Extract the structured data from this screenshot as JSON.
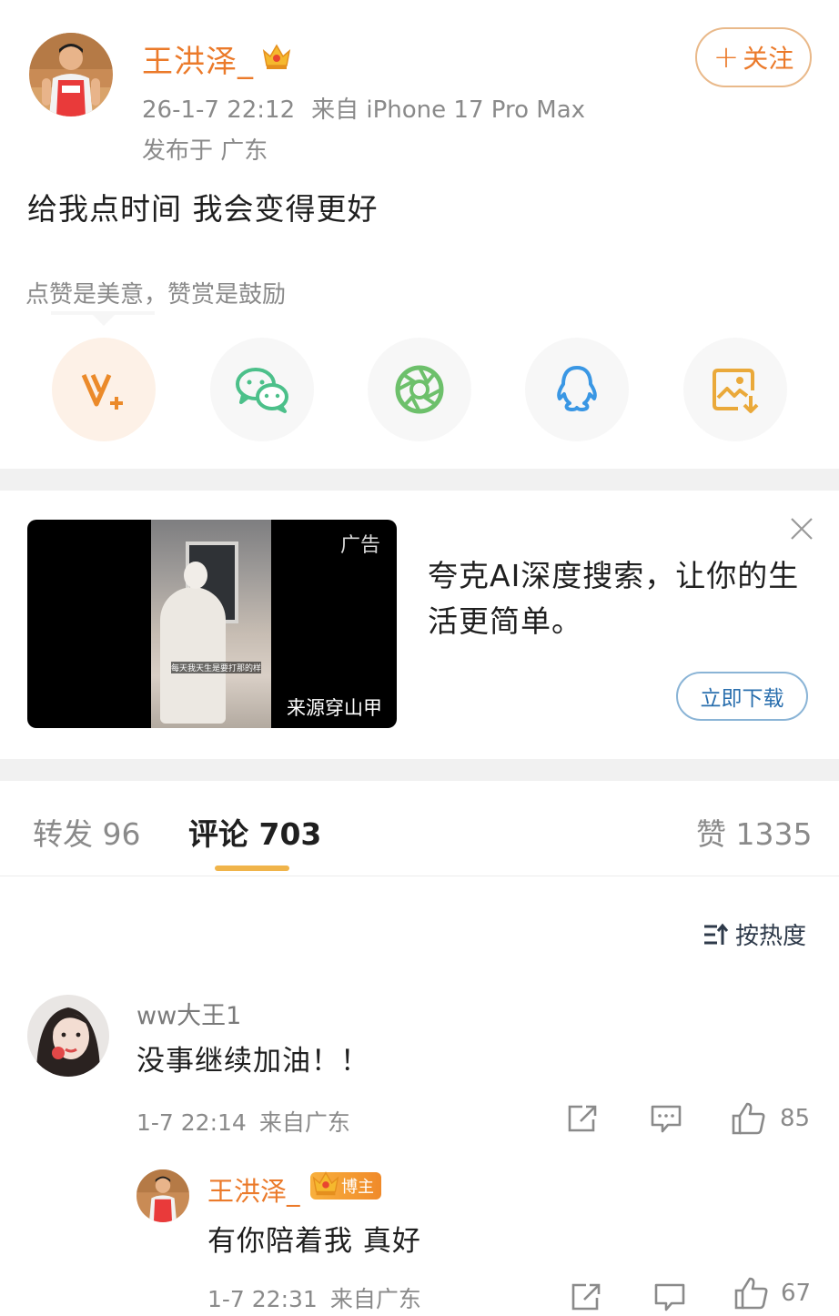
{
  "post": {
    "username": "王洪泽_",
    "timestamp": "26-1-7 22:12",
    "source": "来自 iPhone 17 Pro Max",
    "location": "发布于 广东",
    "follow_label": "关注",
    "follow_plus": "+",
    "content": "给我点时间 我会变得更好"
  },
  "reward": {
    "tip": "点赞是美意，赞赏是鼓励"
  },
  "share": {
    "icons": [
      "reward-v-plus-icon",
      "wechat-icon",
      "moments-icon",
      "qq-icon",
      "save-image-icon"
    ]
  },
  "ad": {
    "tag": "广告",
    "source": "来源穿山甲",
    "caption": "每天我天生是要打那的样",
    "headline": "夸克AI深度搜索，让你的生活更简单。",
    "download_label": "立即下载"
  },
  "tabs": {
    "repost": "转发 96",
    "comments": "评论 703",
    "likes": "赞 1335"
  },
  "sort": {
    "label": "按热度"
  },
  "comments": [
    {
      "username": "ww大王1",
      "text": "没事继续加油！！",
      "time": "1-7 22:14",
      "source": "来自广东",
      "likes": "85"
    }
  ],
  "reply": {
    "username": "王洪泽_",
    "badge": "博主",
    "text": "有你陪着我 真好",
    "time": "1-7 22:31",
    "source": "来自广东",
    "likes": "67"
  },
  "colors": {
    "accent": "#eb7a2a",
    "tab_indicator": "#f0b44a",
    "link_blue": "#2a6fae"
  }
}
